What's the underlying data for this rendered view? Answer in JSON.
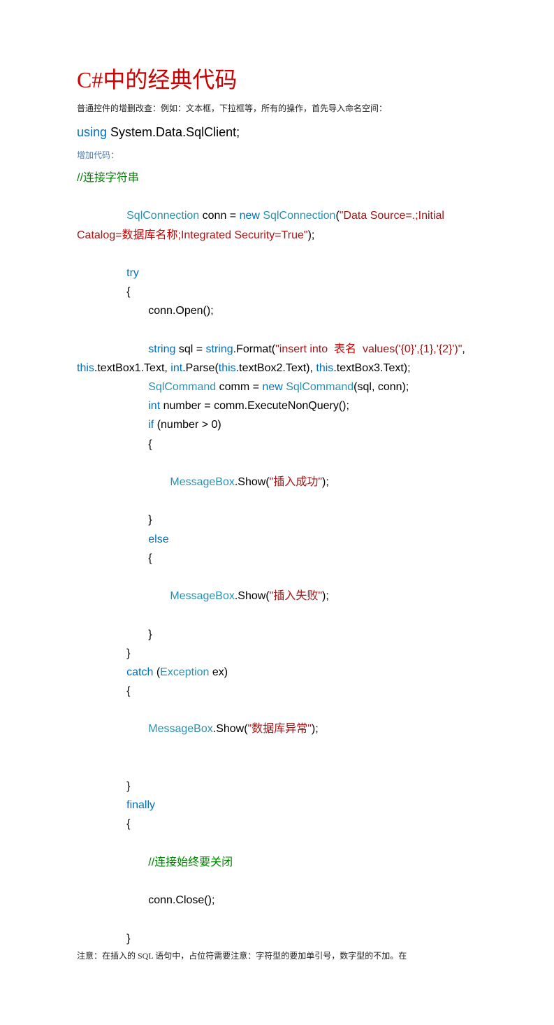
{
  "title": "C#中的经典代码",
  "intro": "普通控件的增删改查：例如：文本框，下拉框等，所有的操作，首先导入命名空间：",
  "using": {
    "kw": "using",
    "ns": " System.Data.SqlClient;"
  },
  "section_label": "增加代码：",
  "code": {
    "c1": "//连接字符串",
    "l2a": "SqlConnection",
    "l2b": " conn = ",
    "l2c": "new",
    "l2d": " SqlConnection",
    "l2e": "(",
    "l2f": "\"Data Source=.;Initial Catalog=",
    "l2g": "数据库名称",
    "l2h": ";Integrated Security=True\"",
    "l2i": ");",
    "l3": "try",
    "l4": "{",
    "l5": "conn.Open();",
    "l6a": "string",
    "l6b": " sql = ",
    "l6c": "string",
    "l6d": ".Format(",
    "l6e": "\"insert into ",
    "l6f": " 表名 ",
    "l6g": " values('{0}',{1},'{2}')\"",
    "l6h": ", ",
    "l6i": "this",
    "l6j": ".textBox1.Text, ",
    "l6k": "int",
    "l6l": ".Parse(",
    "l6m": "this",
    "l6n": ".textBox2.Text), ",
    "l6o": "this",
    "l6p": ".textBox3.Text);",
    "l7a": "SqlCommand",
    "l7b": " comm = ",
    "l7c": "new",
    "l7d": " SqlCommand",
    "l7e": "(sql, conn);",
    "l8a": "int",
    "l8b": " number = comm.ExecuteNonQuery();",
    "l9a": "if",
    "l9b": " (number > 0)",
    "l10": "{",
    "l11a": "MessageBox",
    "l11b": ".Show(",
    "l11c": "\"插入成功\"",
    "l11d": ");",
    "l12": "}",
    "l13": "else",
    "l14": "{",
    "l15a": "MessageBox",
    "l15b": ".Show(",
    "l15c": "\"插入失败\"",
    "l15d": ");",
    "l16": "}",
    "l17": "}",
    "l18a": "catch",
    "l18b": " (",
    "l18c": "Exception",
    "l18d": " ex)",
    "l19": "{",
    "l20a": "MessageBox",
    "l20b": ".Show(",
    "l20c": "\"数据库异常\"",
    "l20d": ");",
    "l21": "}",
    "l22": "finally",
    "l23": "{",
    "l24": "//连接始终要关闭",
    "l25": "conn.Close();",
    "l26": "}"
  },
  "note": "注意：在插入的 SQL 语句中，占位符需要注意：字符型的要加单引号，数字型的不加。在"
}
